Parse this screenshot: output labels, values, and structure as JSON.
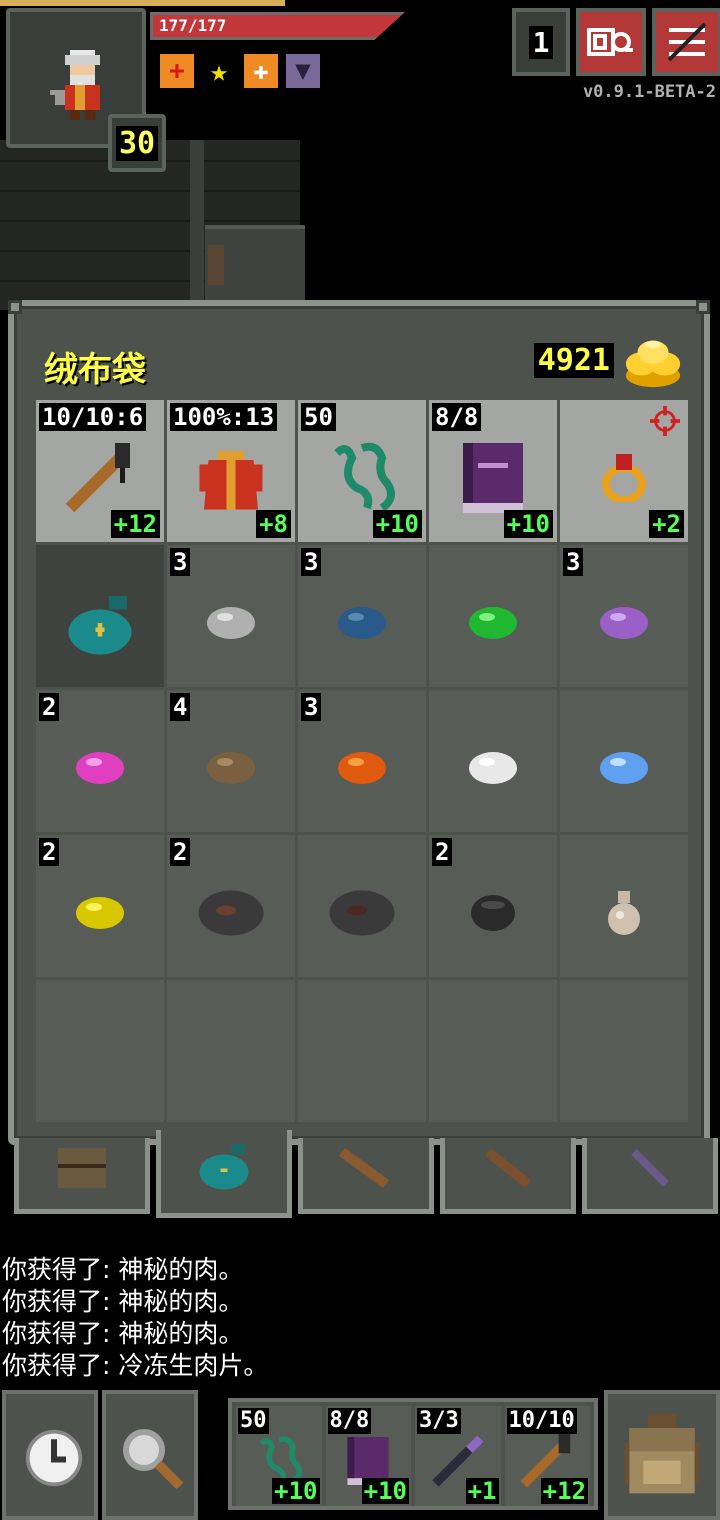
{
  "status": {
    "hp_text": "177/177",
    "hp_fraction": 1.0,
    "level": "30",
    "depth": "1",
    "version": "v0.9.1-BETA-2",
    "buffs": [
      "buff-red-cross-icon",
      "buff-yellow-star-icon",
      "buff-white-cross-icon",
      "buff-purple-shield-icon"
    ]
  },
  "inventory": {
    "title": "绒布袋",
    "gold": "4921",
    "equipped": [
      {
        "name": "staff",
        "qty": "10/10:6",
        "level": "+12"
      },
      {
        "name": "robe",
        "qty": "100%:13",
        "level": "+8"
      },
      {
        "name": "chain",
        "qty": "50",
        "level": "+10"
      },
      {
        "name": "spellbook",
        "qty": "8/8",
        "level": "+10"
      },
      {
        "name": "ring",
        "qty": "",
        "level": "+2"
      }
    ],
    "items": [
      {
        "name": "velvet-pouch",
        "qty": ""
      },
      {
        "name": "gray-seed",
        "qty": "3"
      },
      {
        "name": "blue-seed",
        "qty": "3"
      },
      {
        "name": "green-seed",
        "qty": ""
      },
      {
        "name": "violet-seed",
        "qty": "3"
      },
      {
        "name": "pink-seed",
        "qty": "2"
      },
      {
        "name": "brown-seed",
        "qty": "4"
      },
      {
        "name": "orange-seed",
        "qty": "3"
      },
      {
        "name": "white-seed",
        "qty": ""
      },
      {
        "name": "light-blue-seed",
        "qty": ""
      },
      {
        "name": "yellow-seed",
        "qty": "2"
      },
      {
        "name": "dark-meat",
        "qty": "2"
      },
      {
        "name": "dark-meat-2",
        "qty": ""
      },
      {
        "name": "black-stone",
        "qty": "2"
      },
      {
        "name": "bone-flask",
        "qty": ""
      }
    ]
  },
  "log": [
    "你获得了: 神秘的肉。",
    "你获得了: 神秘的肉。",
    "你获得了: 神秘的肉。",
    "你获得了: 冷冻生肉片。"
  ],
  "quickslots": [
    {
      "name": "chain",
      "qty": "50",
      "level": "+10"
    },
    {
      "name": "spellbook",
      "qty": "8/8",
      "level": "+10"
    },
    {
      "name": "wand",
      "qty": "3/3",
      "level": "+1"
    },
    {
      "name": "staff",
      "qty": "10/10",
      "level": "+12"
    }
  ],
  "colors": {
    "accent_yellow": "#ffff44",
    "level_green": "#55ff55",
    "hp_red": "#c3373a",
    "panel_bg": "#4d524d"
  }
}
